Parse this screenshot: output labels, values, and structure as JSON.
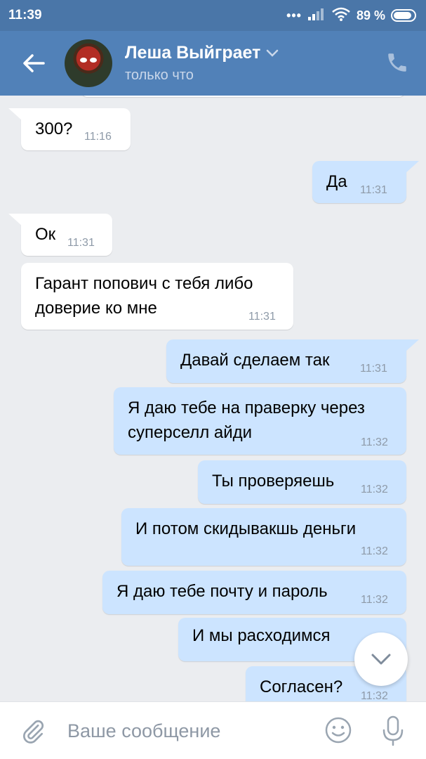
{
  "status_bar": {
    "time": "11:39",
    "signal_dots": "•••",
    "battery_percent": "89 %",
    "battery_level": 0.89
  },
  "header": {
    "contact_name": "Леша Выйграет",
    "contact_status": "только что",
    "icons": {
      "back": "back-arrow-icon",
      "dropdown": "chevron-down-icon",
      "call": "phone-icon"
    }
  },
  "messages": [
    {
      "direction": "in",
      "lines": [
        "300?"
      ],
      "time": "11:16"
    },
    {
      "direction": "out",
      "lines": [
        "Да"
      ],
      "time": "11:31"
    },
    {
      "direction": "in",
      "lines": [
        "Ок"
      ],
      "time": "11:31"
    },
    {
      "direction": "in",
      "lines": [
        "Гарант попович с тебя либо",
        "доверие ко мне"
      ],
      "time": "11:31"
    },
    {
      "direction": "out",
      "lines": [
        "Давай сделаем так"
      ],
      "time": "11:31"
    },
    {
      "direction": "out",
      "lines": [
        "Я даю тебе на праверку через",
        "суперселл айди"
      ],
      "time": "11:32"
    },
    {
      "direction": "out",
      "lines": [
        "Ты проверяешь"
      ],
      "time": "11:32"
    },
    {
      "direction": "out",
      "lines": [
        "И потом скидывакшь деньги"
      ],
      "time": "11:32"
    },
    {
      "direction": "out",
      "lines": [
        "Я даю тебе почту и пароль"
      ],
      "time": "11:32"
    },
    {
      "direction": "out",
      "lines": [
        "И мы расходимся"
      ],
      "time": ""
    },
    {
      "direction": "out",
      "lines": [
        "Согласен?"
      ],
      "time": "11:32"
    }
  ],
  "composer": {
    "placeholder": "Ваше сообщение",
    "value": "",
    "icons": {
      "attach": "paperclip-icon",
      "emoji": "smile-icon",
      "voice": "microphone-icon"
    }
  },
  "colors": {
    "status_bar": "#4a76a8",
    "header": "#5181b8",
    "incoming_bubble": "#ffffff",
    "outgoing_bubble": "#cce4ff",
    "background": "#ebedf0"
  }
}
